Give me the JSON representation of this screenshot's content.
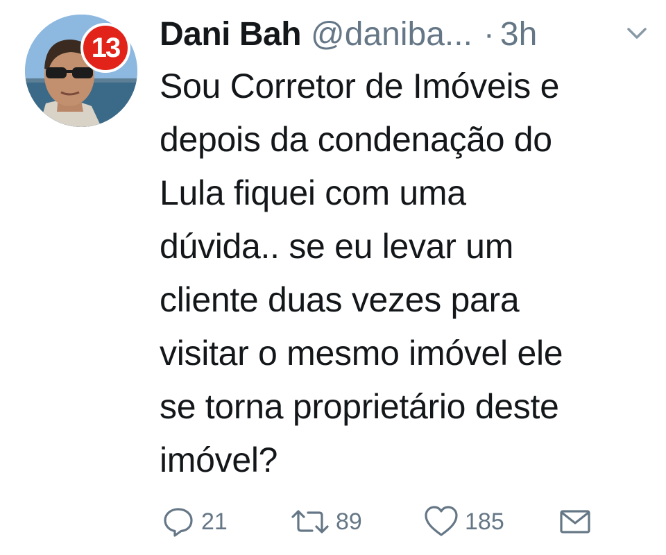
{
  "tweet": {
    "author_name": "Dani Bah",
    "author_handle": "@daniba...",
    "separator": "·",
    "time": "3h",
    "avatar_badge": "13",
    "text_lines": [
      "Sou Corretor de Imóveis e",
      "depois da condenação do",
      "Lula fiquei com uma",
      "dúvida.. se eu levar um",
      "cliente duas vezes para",
      "visitar o mesmo imóvel ele",
      "se torna proprietário deste",
      "imóvel?"
    ],
    "replies": "21",
    "retweets": "89",
    "likes": "185"
  },
  "icons": {
    "reply": "speech-bubble-icon",
    "retweet": "retweet-icon",
    "like": "heart-icon",
    "dm": "envelope-icon",
    "menu": "chevron-down-icon"
  },
  "colors": {
    "text": "#14171a",
    "secondary": "#657786",
    "badge": "#e2231a"
  }
}
